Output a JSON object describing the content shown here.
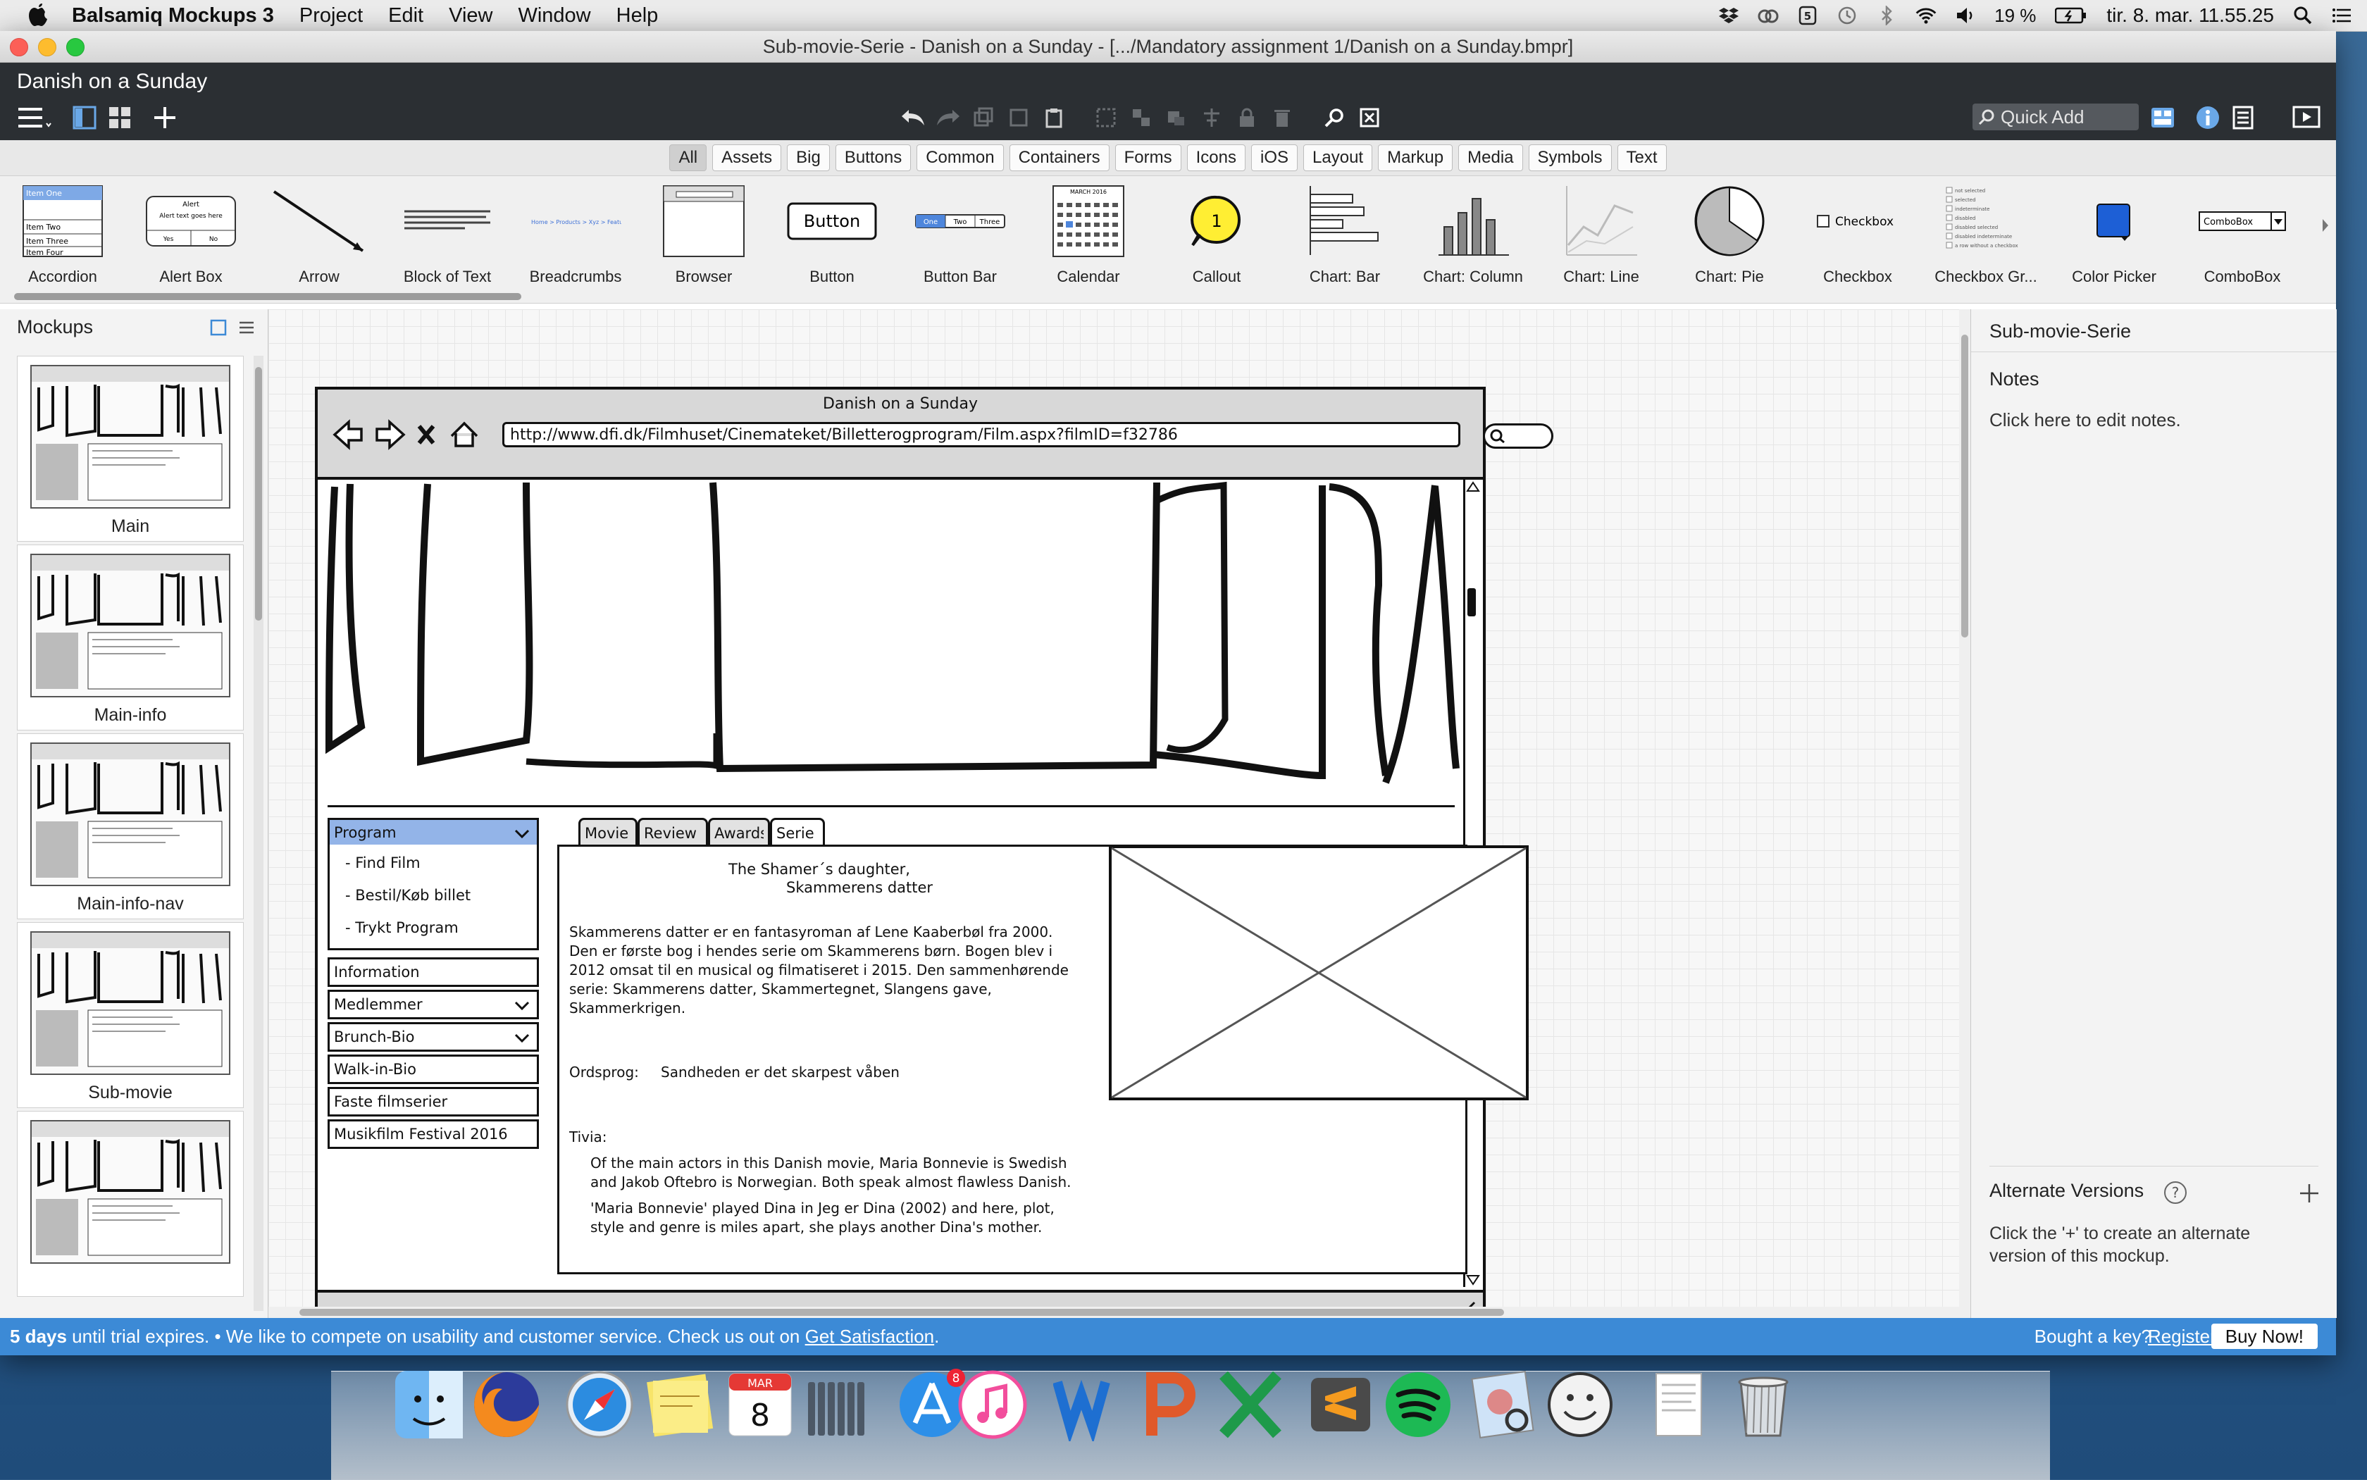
{
  "menubar": {
    "app_name": "Balsamiq Mockups 3",
    "items": [
      "Project",
      "Edit",
      "View",
      "Window",
      "Help"
    ],
    "battery": "19 %",
    "clock": "tir. 8. mar. 11.55.25"
  },
  "window": {
    "title": "Sub-movie-Serie - Danish on a Sunday - [.../Mandatory assignment 1/Danish on a Sunday.bmpr]",
    "doc_title": "Danish on a Sunday",
    "quick_add_placeholder": "Quick Add"
  },
  "categories": [
    "All",
    "Assets",
    "Big",
    "Buttons",
    "Common",
    "Containers",
    "Forms",
    "Icons",
    "iOS",
    "Layout",
    "Markup",
    "Media",
    "Symbols",
    "Text"
  ],
  "components": [
    {
      "label": "Accordion",
      "icon": "accordion-thumb"
    },
    {
      "label": "Alert Box",
      "icon": "alert-box-thumb"
    },
    {
      "label": "Arrow",
      "icon": "arrow-thumb"
    },
    {
      "label": "Block of Text",
      "icon": "text-block-thumb"
    },
    {
      "label": "Breadcrumbs",
      "icon": "breadcrumbs-thumb"
    },
    {
      "label": "Browser",
      "icon": "browser-thumb"
    },
    {
      "label": "Button",
      "icon": "button-thumb"
    },
    {
      "label": "Button Bar",
      "icon": "button-bar-thumb"
    },
    {
      "label": "Calendar",
      "icon": "calendar-thumb"
    },
    {
      "label": "Callout",
      "icon": "callout-thumb"
    },
    {
      "label": "Chart: Bar",
      "icon": "chart-bar-thumb"
    },
    {
      "label": "Chart: Column",
      "icon": "chart-column-thumb"
    },
    {
      "label": "Chart: Line",
      "icon": "chart-line-thumb"
    },
    {
      "label": "Chart: Pie",
      "icon": "chart-pie-thumb"
    },
    {
      "label": "Checkbox",
      "icon": "checkbox-thumb"
    },
    {
      "label": "Checkbox Gr...",
      "icon": "checkbox-group-thumb"
    },
    {
      "label": "Color Picker",
      "icon": "color-picker-thumb"
    },
    {
      "label": "ComboBox",
      "icon": "combobox-thumb"
    }
  ],
  "component_thumb_text": {
    "button": "Button",
    "checkbox": "Checkbox",
    "combobox": "ComboBox",
    "accordion_items": [
      "Item One",
      "Item Two",
      "Item Three",
      "Item Four"
    ],
    "alert": "Alert",
    "alert_body": "Alert text goes here",
    "alert_yes": "Yes",
    "alert_no": "No",
    "button_bar": [
      "One",
      "Two",
      "Three"
    ],
    "calendar_month": "MARCH 2016",
    "breadcrumbs": "Home > Products > Xyz > Features",
    "checkbox_group": [
      "not selected",
      "selected",
      "indeterminate",
      "disabled",
      "disabled selected",
      "disabled indeterminate",
      "a row without a checkbox"
    ]
  },
  "mockups_panel": {
    "title": "Mockups",
    "items": [
      "Main",
      "Main-info",
      "Main-info-nav",
      "Sub-movie",
      ""
    ]
  },
  "right_panel": {
    "title": "Sub-movie-Serie",
    "notes_label": "Notes",
    "notes_hint": "Click here to edit notes.",
    "alt_versions_label": "Alternate Versions",
    "alt_versions_hint": "Click the '+' to create an alternate version of this mockup."
  },
  "trial": {
    "days": "5 days",
    "text_before": " until trial expires. • We like to compete on usability and customer service. Check us out on ",
    "link": "Get Satisfaction",
    "text_after": ".",
    "key_prompt": "Bought a key?",
    "register": "Register...",
    "buy": "Buy Now!"
  },
  "mockup": {
    "browser_title": "Danish on a Sunday",
    "url": "http://www.dfi.dk/Filmhuset/Cinemateket/Billetterogprogram/Film.aspx?filmID=f32786",
    "nav": {
      "program": "Program",
      "sub_items": [
        "- Find Film",
        "- Bestil/Køb billet",
        "- Trykt Program"
      ],
      "items": [
        "Information",
        "Medlemmer",
        "Brunch-Bio",
        "Walk-in-Bio",
        "Faste filmserier",
        "Musikfilm Festival 2016"
      ]
    },
    "tabs": [
      "Movie",
      "Review",
      "Awards",
      "Serie"
    ],
    "heading_en": "The Shamer´s daughter,",
    "heading_da": "Skammerens datter",
    "description": "Skammerens datter er en fantasyroman af Lene Kaaberbøl fra 2000. Den er første bog i hendes serie om Skammerens børn. Bogen blev i 2012 omsat til en musical og filmatiseret i 2015. Den sammenhørende serie: Skammerens datter, Skammertegnet, Slangens gave, Skammerkrigen.",
    "ordsprog_label": "Ordsprog:",
    "ordsprog_text": "Sandheden er det skarpest våben",
    "trivia_label": "Tivia:",
    "trivia_1": "Of the main actors in this Danish movie, Maria Bonnevie is Swedish and Jakob Oftebro is Norwegian. Both speak almost flawless Danish.",
    "trivia_2": "'Maria Bonnevie' played Dina in Jeg er Dina (2002) and here, plot, style and genre is miles apart, she plays another Dina's mother."
  },
  "dock": {
    "apps": [
      "finder-icon",
      "firefox-icon",
      "safari-icon",
      "stickies-icon",
      "calendar-icon",
      "launchpad-icon",
      "app-store-icon",
      "itunes-icon",
      "word-icon",
      "powerpoint-icon",
      "excel-icon",
      "sublime-icon",
      "spotify-icon",
      "preview-icon",
      "smiley-icon",
      "document-icon",
      "trash-icon"
    ],
    "calendar_month": "MAR",
    "calendar_day": "8",
    "app_store_badge": "8"
  }
}
